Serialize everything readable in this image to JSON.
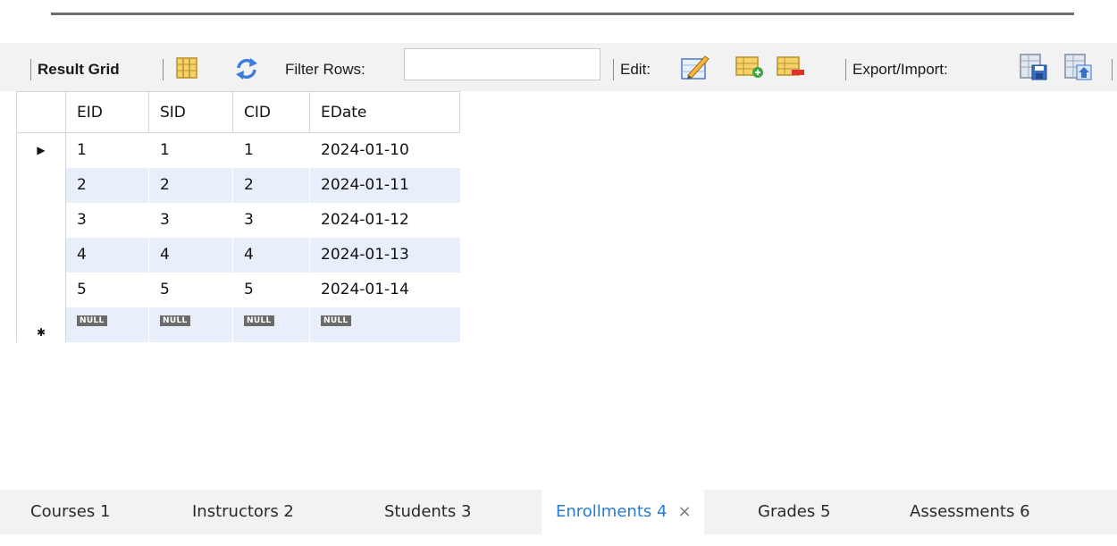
{
  "toolbar": {
    "result_grid_label": "Result Grid",
    "filter_label": "Filter Rows:",
    "filter_value": "",
    "edit_label": "Edit:",
    "export_label": "Export/Import:"
  },
  "grid": {
    "columns": [
      "EID",
      "SID",
      "CID",
      "EDate"
    ],
    "rows": [
      [
        "1",
        "1",
        "1",
        "2024-01-10"
      ],
      [
        "2",
        "2",
        "2",
        "2024-01-11"
      ],
      [
        "3",
        "3",
        "3",
        "2024-01-12"
      ],
      [
        "4",
        "4",
        "4",
        "2024-01-13"
      ],
      [
        "5",
        "5",
        "5",
        "2024-01-14"
      ]
    ],
    "new_row": [
      "NULL",
      "NULL",
      "NULL",
      "NULL"
    ],
    "current_row_marker": "▶",
    "new_row_marker": "✱"
  },
  "tabs": [
    {
      "label": "Courses 1"
    },
    {
      "label": "Instructors 2"
    },
    {
      "label": "Students 3"
    },
    {
      "label": "Enrollments 4",
      "close": "×"
    },
    {
      "label": "Grades 5"
    },
    {
      "label": "Assessments 6"
    }
  ],
  "colors": {
    "active_tab": "#2a7bd4",
    "row_alt": "#e8eefa",
    "toolbar_bg": "#f2f2f2"
  },
  "icons": [
    "grid-layout-icon",
    "refresh-icon",
    "edit-pencil-icon",
    "add-row-icon",
    "delete-row-icon",
    "export-icon",
    "import-icon"
  ]
}
